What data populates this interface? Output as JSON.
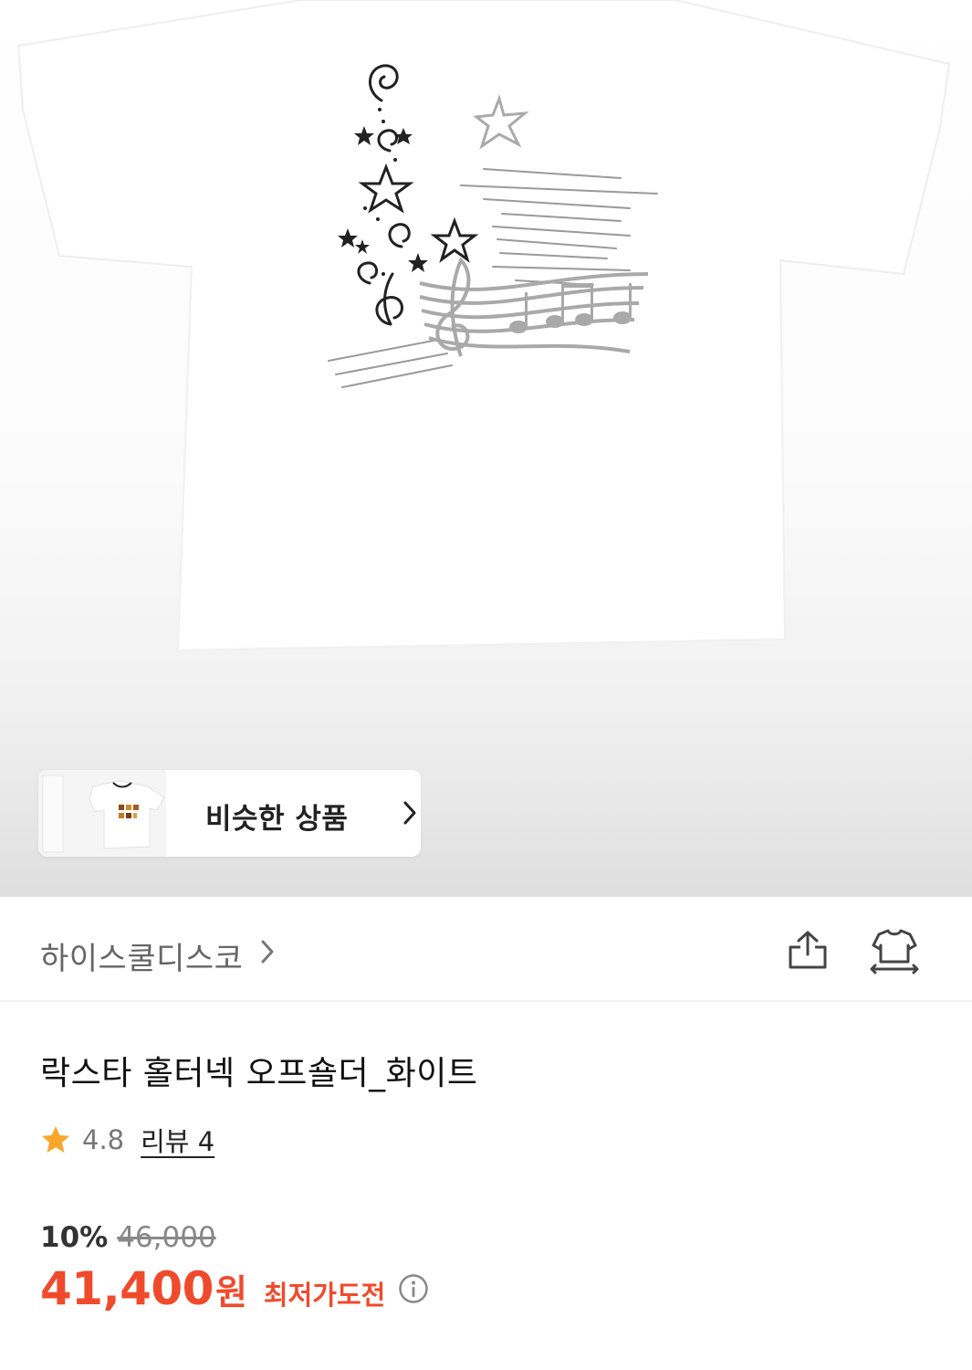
{
  "similar_products": {
    "label": "비슷한 상품"
  },
  "brand": {
    "name": "하이스쿨디스코"
  },
  "product": {
    "title": "락스타 홀터넥 오프숄더_화이트",
    "rating": "4.8",
    "review_label": "리뷰 4"
  },
  "price": {
    "discount_rate": "10%",
    "original": "46,000",
    "sale": "41,400",
    "currency": "원",
    "challenge_label": "최저가도전"
  },
  "icons": {
    "share": "share-icon",
    "fitting": "tshirt-fitting-icon",
    "star": "star-icon",
    "info": "info-icon",
    "chevron": "chevron-right-icon"
  },
  "colors": {
    "accent": "#f04a2c",
    "star": "#f8a72c",
    "muted_text": "#777777"
  }
}
